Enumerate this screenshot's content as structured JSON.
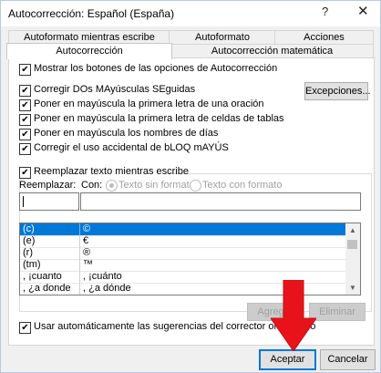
{
  "window": {
    "title": "Autocorrección: Español (España)",
    "help": "?",
    "close": "✕"
  },
  "tabs": {
    "row1": [
      "Autoformato mientras escribe",
      "Autoformato",
      "Acciones"
    ],
    "row2": [
      "Autocorrección",
      "Autocorrección matemática"
    ]
  },
  "options": {
    "show_buttons": "Mostrar los botones de las opciones de Autocorrección",
    "correct_two_caps": "Corregir DOs MAyúsculas SEguidas",
    "capitalize_sentence": "Poner en mayúscula la primera letra de una oración",
    "capitalize_cells": "Poner en mayúscula la primera letra de celdas de tablas",
    "capitalize_days": "Poner en mayúscula los nombres de días",
    "caps_lock": "Corregir el uso accidental de bLOQ mAYÚS"
  },
  "buttons": {
    "exceptions": "Excepciones...",
    "add": "Agregar",
    "delete": "Eliminar",
    "accept": "Aceptar",
    "cancel": "Cancelar"
  },
  "replace": {
    "group_label": "Reemplazar texto mientras escribe",
    "replace_label": "Reemplazar:",
    "with_label": "Con:",
    "plain_text": "Texto sin formato",
    "formatted_text": "Texto con formato",
    "replace_value": "",
    "with_value": ""
  },
  "list": {
    "rows": [
      {
        "from": "(c)",
        "to": "©"
      },
      {
        "from": "(e)",
        "to": "€"
      },
      {
        "from": "(r)",
        "to": "®"
      },
      {
        "from": "(tm)",
        "to": "™"
      },
      {
        "from": ", ¡cuanto",
        "to": ", ¡cuánto"
      },
      {
        "from": ", ¿a donde",
        "to": ", ¿a dónde"
      }
    ]
  },
  "spell_suggestions": "Usar automáticamente las sugerencias del corrector ortográfico",
  "colors": {
    "selection": "#0078d7",
    "arrow": "#e8131a"
  }
}
